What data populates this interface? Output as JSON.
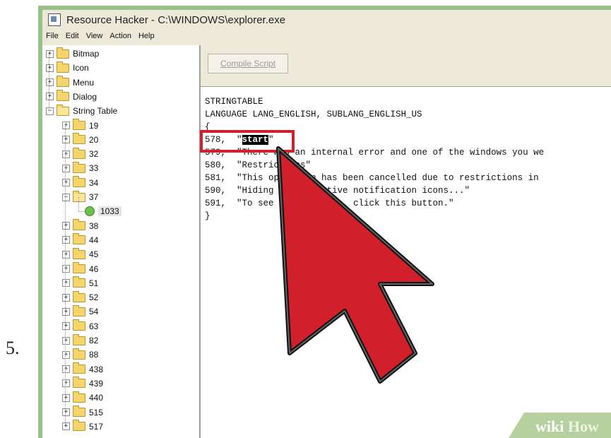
{
  "step_number": "5.",
  "window": {
    "title": "Resource Hacker  -  C:\\WINDOWS\\explorer.exe"
  },
  "menu": [
    "File",
    "Edit",
    "View",
    "Action",
    "Help"
  ],
  "tree": {
    "top_level": [
      {
        "label": "Bitmap",
        "expander": "+"
      },
      {
        "label": "Icon",
        "expander": "+"
      },
      {
        "label": "Menu",
        "expander": "+"
      },
      {
        "label": "Dialog",
        "expander": "+"
      },
      {
        "label": "String Table",
        "expander": "−"
      }
    ],
    "string_table_children": [
      {
        "label": "19",
        "expander": "+"
      },
      {
        "label": "20",
        "expander": "+"
      },
      {
        "label": "32",
        "expander": "+"
      },
      {
        "label": "33",
        "expander": "+"
      },
      {
        "label": "34",
        "expander": "+"
      },
      {
        "label": "37",
        "expander": "−"
      },
      {
        "label": "1033",
        "leaf": true
      },
      {
        "label": "38",
        "expander": "+"
      },
      {
        "label": "44",
        "expander": "+"
      },
      {
        "label": "45",
        "expander": "+"
      },
      {
        "label": "46",
        "expander": "+"
      },
      {
        "label": "51",
        "expander": "+"
      },
      {
        "label": "52",
        "expander": "+"
      },
      {
        "label": "54",
        "expander": "+"
      },
      {
        "label": "63",
        "expander": "+"
      },
      {
        "label": "82",
        "expander": "+"
      },
      {
        "label": "88",
        "expander": "+"
      },
      {
        "label": "438",
        "expander": "+"
      },
      {
        "label": "439",
        "expander": "+"
      },
      {
        "label": "440",
        "expander": "+"
      },
      {
        "label": "515",
        "expander": "+"
      },
      {
        "label": "517",
        "expander": "+"
      }
    ]
  },
  "toolbar": {
    "compile_label": "Compile Script"
  },
  "editor": {
    "lines": [
      {
        "text": "STRINGTABLE"
      },
      {
        "text": "LANGUAGE LANG_ENGLISH, SUBLANG_ENGLISH_US"
      },
      {
        "text": "{"
      },
      {
        "prefix": "578,  \"",
        "highlight": "start",
        "suffix": "\""
      },
      {
        "text": "579,  \"There was an internal error and one of the windows you we"
      },
      {
        "text": "580,  \"Restrictions\""
      },
      {
        "text": "581,  \"This operation has been cancelled due to restrictions in"
      },
      {
        "text": "590,  \"Hiding your inactive notification icons...\""
      },
      {
        "text": "591,  \"To see hidden icons, click this button.\""
      },
      {
        "text": "}"
      }
    ]
  },
  "watermark": {
    "part1": "wiki",
    "part2": "How"
  },
  "colors": {
    "accent_red": "#d21f2c",
    "frame_green": "#9ac08a"
  }
}
